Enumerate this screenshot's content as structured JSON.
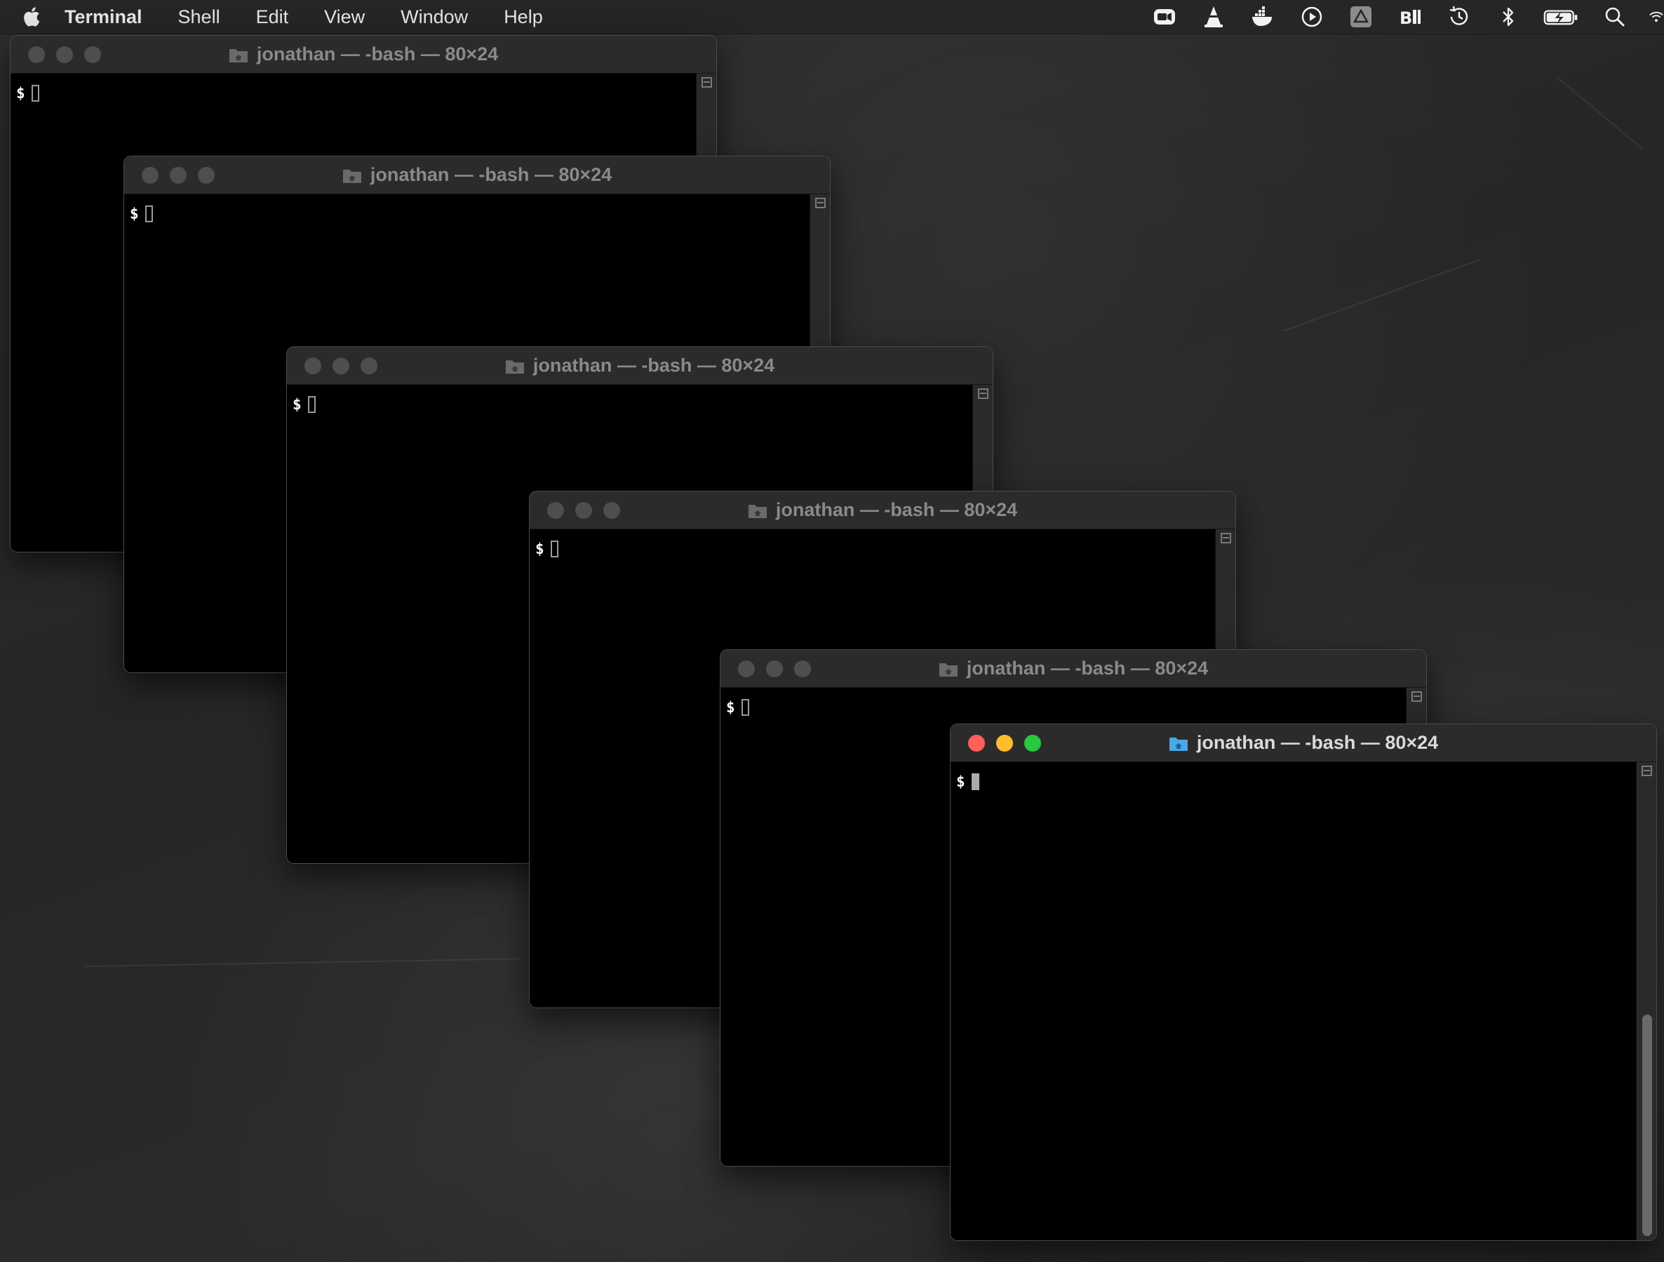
{
  "menubar": {
    "apple_icon": "apple-logo-icon",
    "app_name": "Terminal",
    "menus": [
      "Shell",
      "Edit",
      "View",
      "Window",
      "Help"
    ],
    "status_icons": [
      "zoom-video-icon",
      "vlc-cone-icon",
      "docker-whale-icon",
      "play-circle-icon",
      "google-drive-icon",
      "bi-app-icon",
      "time-machine-icon",
      "bluetooth-icon",
      "battery-charging-icon",
      "spotlight-search-icon",
      "wifi-icon"
    ]
  },
  "windows": [
    {
      "title": "jonathan — -bash — 80×24",
      "prompt": "$",
      "active": false
    },
    {
      "title": "jonathan — -bash — 80×24",
      "prompt": "$",
      "active": false
    },
    {
      "title": "jonathan — -bash — 80×24",
      "prompt": "$",
      "active": false
    },
    {
      "title": "jonathan — -bash — 80×24",
      "prompt": "$",
      "active": false
    },
    {
      "title": "jonathan — -bash — 80×24",
      "prompt": "$",
      "active": false
    },
    {
      "title": "jonathan — -bash — 80×24",
      "prompt": "$",
      "active": true
    }
  ],
  "colors": {
    "close": "#ff5f57",
    "minimize": "#febc2e",
    "zoom": "#28c840",
    "inactive_light": "#4e4e4e",
    "folder_active": "#4aa8e8"
  }
}
